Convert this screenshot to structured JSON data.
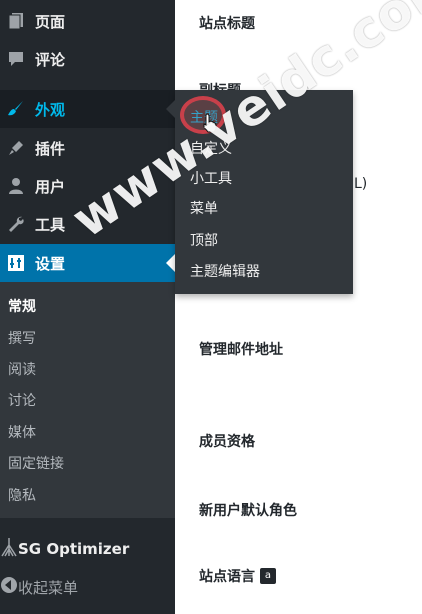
{
  "sidebar": {
    "items": [
      {
        "label": "页面",
        "icon": "page-icon"
      },
      {
        "label": "评论",
        "icon": "comment-icon"
      },
      {
        "label": "外观",
        "icon": "brush-icon"
      },
      {
        "label": "插件",
        "icon": "plug-icon"
      },
      {
        "label": "用户",
        "icon": "user-icon"
      },
      {
        "label": "工具",
        "icon": "wrench-icon"
      },
      {
        "label": "设置",
        "icon": "settings-icon"
      }
    ],
    "settings_submenu": [
      "常规",
      "撰写",
      "阅读",
      "讨论",
      "媒体",
      "固定链接",
      "隐私"
    ],
    "sg_optimizer": "SG Optimizer",
    "collapse": "收起菜单"
  },
  "flyout": {
    "items": [
      "主题",
      "自定义",
      "小工具",
      "菜单",
      "顶部",
      "主题编辑器"
    ]
  },
  "content": {
    "site_title": "站点标题",
    "tagline": "副标题",
    "site_address_fragment": "L)",
    "admin_email": "管理邮件地址",
    "membership": "成员资格",
    "default_role": "新用户默认角色",
    "site_language": "站点语言"
  },
  "watermark": "www.veidc.com",
  "colors": {
    "sidebar_bg": "#23282d",
    "submenu_bg": "#32373c",
    "accent_blue": "#0073aa",
    "hover_text": "#00b9eb",
    "highlight_ring": "#c8404a"
  }
}
